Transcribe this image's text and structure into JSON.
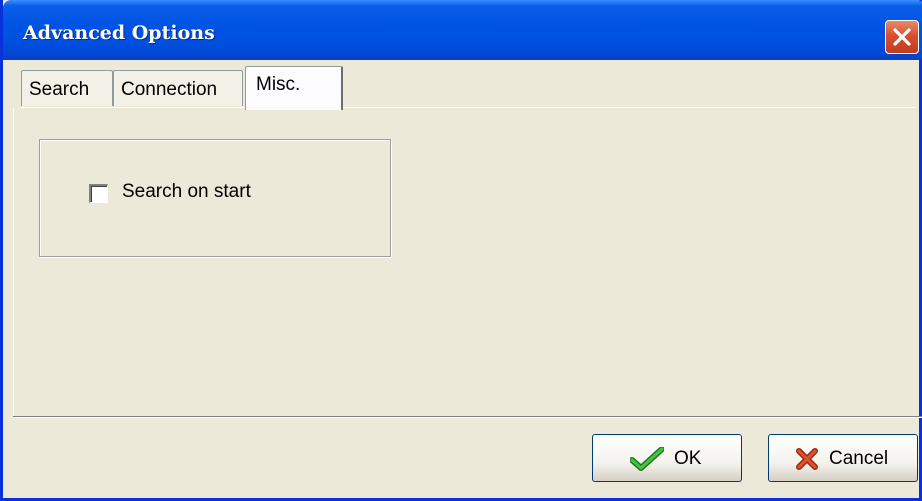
{
  "window": {
    "title": "Advanced Options",
    "close_icon": "close-icon"
  },
  "tabs": [
    {
      "label": "Search",
      "active": false
    },
    {
      "label": "Connection",
      "active": false
    },
    {
      "label": "Misc.",
      "active": true
    }
  ],
  "misc_panel": {
    "search_on_start": {
      "label": "Search on start",
      "checked": false
    }
  },
  "footer": {
    "ok": {
      "label": "OK",
      "icon": "checkmark-icon"
    },
    "cancel": {
      "label": "Cancel",
      "icon": "x-icon"
    }
  },
  "colors": {
    "titlebar": "#0054e3",
    "dialog_bg": "#ece9d8",
    "close_button": "#d8502e",
    "ok_icon": "#2a9a2a",
    "cancel_icon": "#cc3a1a"
  }
}
